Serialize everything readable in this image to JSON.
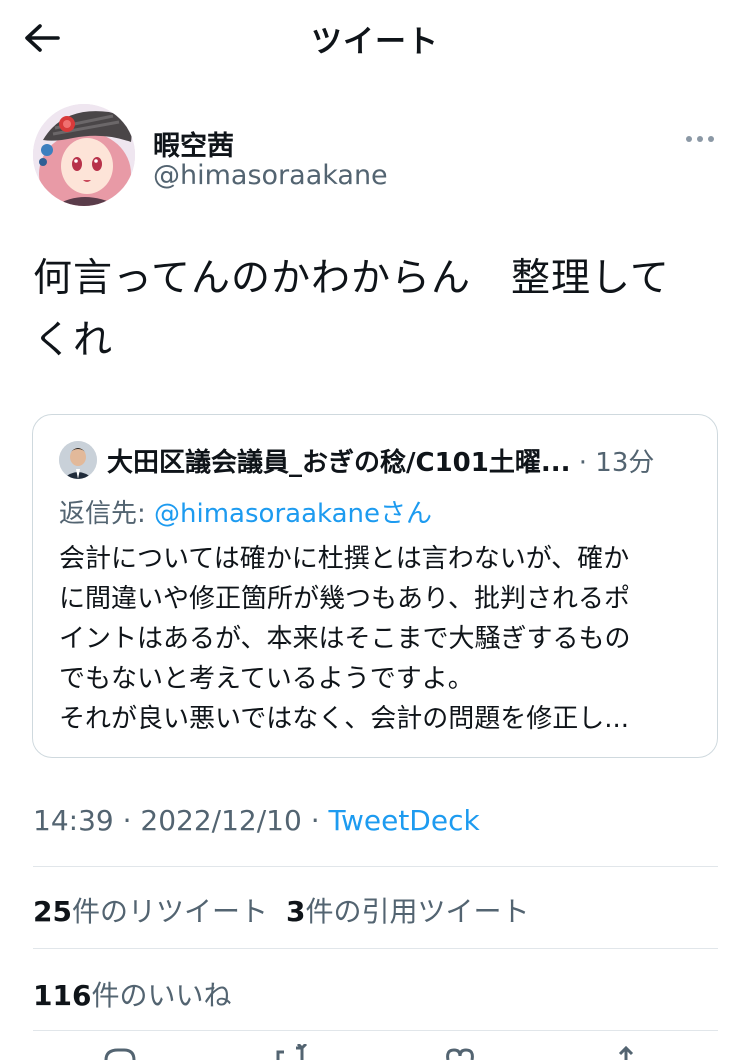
{
  "header": {
    "title": "ツイート"
  },
  "author": {
    "display_name": "暇空茜",
    "handle": "@himasoraakane"
  },
  "tweet": {
    "text_line1": "何言ってんのかわからん　整理して",
    "text_line2": "くれ"
  },
  "quote": {
    "author_name": "大田区議会議員_おぎの稔/C101土曜...",
    "separator": " · ",
    "time": "13分",
    "reply_prefix": "返信先: ",
    "reply_handle": "@himasoraakane",
    "reply_suffix": "さん",
    "lines": [
      "会計については確かに杜撰とは言わないが、確か",
      "に間違いや修正箇所が幾つもあり、批判されるポ",
      "イントはあるが、本来はそこまで大騒ぎするもの",
      "でもないと考えているようですよ。",
      "それが良い悪いではなく、会計の問題を修正し..."
    ]
  },
  "meta": {
    "time": "14:39",
    "dot1": " · ",
    "date": "2022/12/10",
    "dot2": " · ",
    "source": "TweetDeck"
  },
  "stats": {
    "retweets_count": "25",
    "retweets_label": "件のリツイート",
    "quotes_count": "3",
    "quotes_label": "件の引用ツイート",
    "likes_count": "116",
    "likes_label": "件のいいね"
  },
  "actions": {
    "icons": [
      "reply-icon",
      "retweet-icon",
      "like-icon",
      "share-icon"
    ]
  },
  "colors": {
    "text": "#0f1419",
    "secondary": "#536471",
    "link": "#1d9bf0",
    "border": "#cfd9de"
  }
}
